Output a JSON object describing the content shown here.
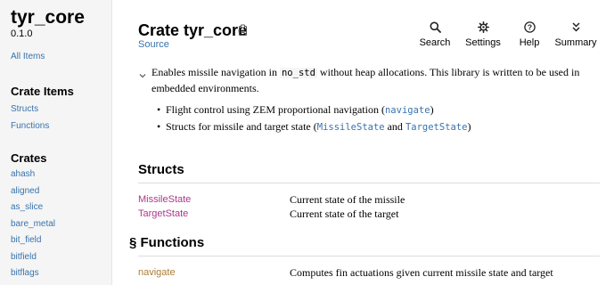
{
  "sidebar": {
    "crate_name": "tyr_core",
    "version": "0.1.0",
    "all_items": "All Items",
    "crate_items_heading": "Crate Items",
    "crate_items": [
      "Structs",
      "Functions"
    ],
    "crates_heading": "Crates",
    "crates": [
      "ahash",
      "aligned",
      "as_slice",
      "bare_metal",
      "bit_field",
      "bitfield",
      "bitflags"
    ]
  },
  "header": {
    "title": "Crate tyr_core",
    "source_label": "Source",
    "toolbar": {
      "search": "Search",
      "settings": "Settings",
      "help": "Help",
      "summary": "Summary"
    }
  },
  "doc": {
    "desc_part1": "Enables missile navigation in ",
    "desc_code": "no_std",
    "desc_part2": " without heap allocations. This library is written to be used in embedded environments.",
    "bullet1_text": "Flight control using ZEM proportional navigation (",
    "bullet1_code": "navigate",
    "bullet1_end": ")",
    "bullet2_text": "Structs for missile and target state (",
    "bullet2_code1": "MissileState",
    "bullet2_and": " and ",
    "bullet2_code2": "TargetState",
    "bullet2_end": ")"
  },
  "structs": {
    "heading": "Structs",
    "items": [
      {
        "name": "MissileState",
        "desc": "Current state of the missile"
      },
      {
        "name": "TargetState",
        "desc": "Current state of the target"
      }
    ]
  },
  "functions": {
    "heading": "§ Functions",
    "items": [
      {
        "name": "navigate",
        "desc": "Computes fin actuations given current missile state and target"
      }
    ]
  },
  "icons": {
    "search": "search-icon",
    "settings": "gear-icon",
    "help": "help-icon",
    "summary": "chevrons-icon",
    "copy": "copy-icon",
    "collapse": "chevron-down-icon"
  },
  "colors": {
    "link": "#3873ad",
    "struct": "#ad378a",
    "function": "#ad7c37",
    "sidebar_bg": "#f5f5f5"
  }
}
